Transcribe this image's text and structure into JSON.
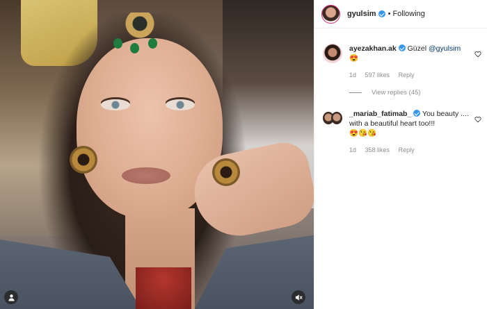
{
  "post": {
    "username": "gyulsim",
    "follow_status": "Following",
    "separator": "•"
  },
  "comments": [
    {
      "username": "ayezakhan.ak",
      "text": "Güzel",
      "mention": "@gyulsim",
      "emoji_line": "😍",
      "age": "1d",
      "likes": "597 likes",
      "reply_label": "Reply",
      "verified": true
    },
    {
      "username": "_mariab_fatimab_",
      "text": "You beauty .... with a beautiful heart too!!!",
      "emoji_line": "😍😘😘",
      "age": "1d",
      "likes": "358 likes",
      "reply_label": "Reply",
      "verified": true
    }
  ],
  "view_replies_label": "View replies (45)",
  "icons": {
    "verified": "verified-badge-icon",
    "heart": "heart-outline-icon",
    "user": "user-tag-icon",
    "mute": "volume-muted-icon"
  },
  "colors": {
    "verified": "#3897f0",
    "mention": "#00376b",
    "muted_text": "#8e8e8e",
    "avatar_ring": "#d62976"
  }
}
